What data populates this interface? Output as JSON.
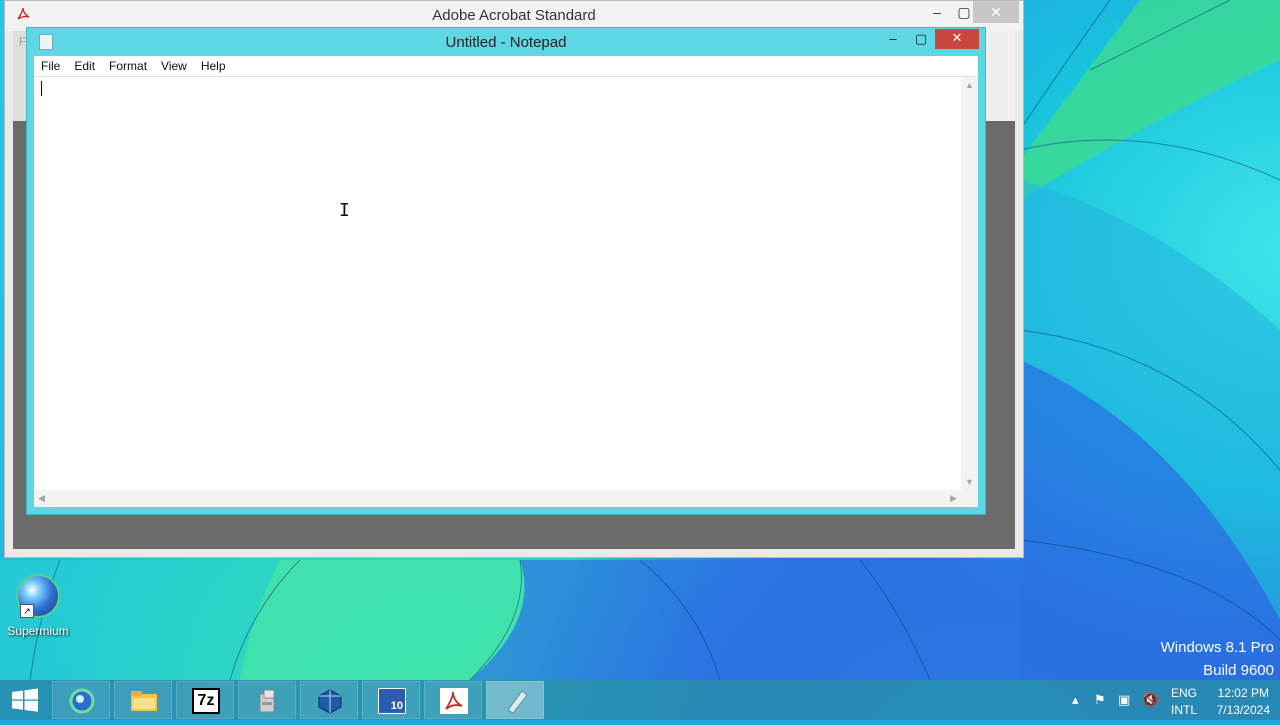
{
  "acrobat": {
    "title": "Adobe Acrobat Standard",
    "sidebar_letter": "F",
    "controls": {
      "minimize": "–",
      "maximize": "▢",
      "close": "✕"
    }
  },
  "notepad": {
    "title": "Untitled - Notepad",
    "menu": [
      "File",
      "Edit",
      "Format",
      "View",
      "Help"
    ],
    "controls": {
      "minimize": "–",
      "maximize": "▢",
      "close": "✕"
    },
    "text": ""
  },
  "desktop": {
    "icons": [
      {
        "label": "Supermium",
        "icon": "supermium-icon"
      }
    ],
    "watermark": {
      "line1": "Windows 8.1 Pro",
      "line2": "Build 9600"
    }
  },
  "taskbar": {
    "buttons": [
      {
        "name": "supermium",
        "icon": "supermium-icon"
      },
      {
        "name": "file-explorer",
        "icon": "folder-icon"
      },
      {
        "name": "7zip",
        "icon": "7zip-icon",
        "text": "7z"
      },
      {
        "name": "installer",
        "icon": "installer-icon"
      },
      {
        "name": "virtualbox",
        "icon": "virtualbox-icon"
      },
      {
        "name": "app-64-10",
        "icon": "app-64-icon",
        "text": "10"
      },
      {
        "name": "adobe-acrobat",
        "icon": "acrobat-icon"
      },
      {
        "name": "notepad",
        "icon": "notepad-icon",
        "active": true
      }
    ],
    "language": {
      "top": "ENG",
      "bottom": "INTL"
    },
    "clock": {
      "time": "12:02 PM",
      "date": "7/13/2024"
    }
  }
}
